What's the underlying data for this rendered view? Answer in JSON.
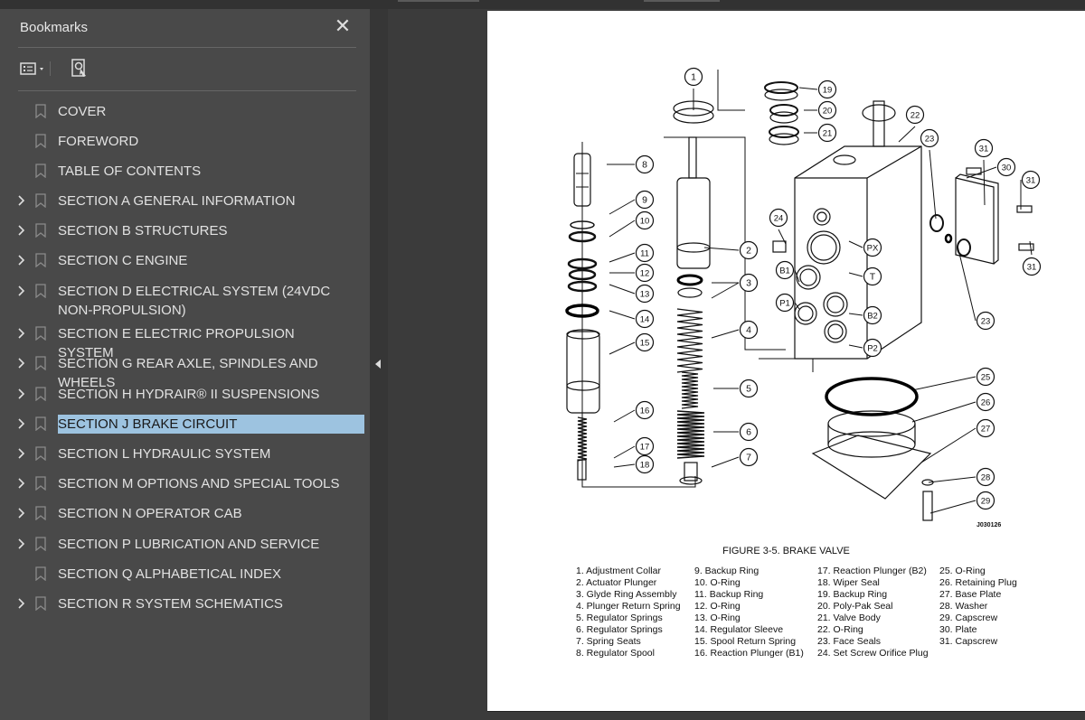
{
  "sidebar": {
    "title": "Bookmarks",
    "close_glyph": "✕",
    "items": [
      {
        "label": "COVER",
        "expandable": false
      },
      {
        "label": "FOREWORD",
        "expandable": false
      },
      {
        "label": "TABLE OF CONTENTS",
        "expandable": false
      },
      {
        "label": "SECTION A GENERAL INFORMATION",
        "expandable": true
      },
      {
        "label": "SECTION B STRUCTURES",
        "expandable": true
      },
      {
        "label": "SECTION C ENGINE",
        "expandable": true
      },
      {
        "label": "SECTION D ELECTRICAL SYSTEM (24VDC NON-PROPULSION)",
        "expandable": true
      },
      {
        "label": "SECTION E ELECTRIC PROPULSION SYSTEM",
        "expandable": true
      },
      {
        "label": "SECTION G REAR AXLE, SPINDLES AND WHEELS",
        "expandable": true
      },
      {
        "label": "SECTION H HYDRAIR® II SUSPENSIONS",
        "expandable": true
      },
      {
        "label": "SECTION J BRAKE CIRCUIT",
        "expandable": true,
        "selected": true
      },
      {
        "label": "SECTION L HYDRAULIC SYSTEM",
        "expandable": true
      },
      {
        "label": "SECTION M OPTIONS AND SPECIAL TOOLS",
        "expandable": true
      },
      {
        "label": "SECTION N OPERATOR CAB",
        "expandable": true
      },
      {
        "label": "SECTION P LUBRICATION AND SERVICE",
        "expandable": true
      },
      {
        "label": "SECTION Q ALPHABETICAL INDEX",
        "expandable": false
      },
      {
        "label": "SECTION R SYSTEM SCHEMATICS",
        "expandable": true
      }
    ]
  },
  "document": {
    "figure_title": "FIGURE 3-5. BRAKE VALVE",
    "figure_id": "J030126",
    "legend": [
      [
        "1. Adjustment Collar",
        "2. Actuator Plunger",
        "3. Glyde Ring Assembly",
        "4. Plunger Return Spring",
        "5. Regulator Springs",
        "6. Regulator Springs",
        "7. Spring Seats",
        "8. Regulator Spool"
      ],
      [
        "9. Backup Ring",
        "10. O-Ring",
        "11. Backup Ring",
        "12. O-Ring",
        "13. O-Ring",
        "14. Regulator Sleeve",
        "15. Spool Return Spring",
        "16. Reaction Plunger (B1)"
      ],
      [
        "17. Reaction Plunger (B2)",
        "18. Wiper Seal",
        "19. Backup Ring",
        "20. Poly-Pak Seal",
        "21. Valve Body",
        "22. O-Ring",
        "23. Face Seals",
        "24. Set Screw Orifice Plug"
      ],
      [
        "25. O-Ring",
        "26. Retaining Plug",
        "27. Base Plate",
        "28. Washer",
        "29. Capscrew",
        "30. Plate",
        "31. Capscrew"
      ]
    ],
    "callouts": [
      "1",
      "2",
      "3",
      "4",
      "5",
      "6",
      "7",
      "8",
      "9",
      "10",
      "11",
      "12",
      "13",
      "14",
      "15",
      "16",
      "17",
      "18",
      "19",
      "20",
      "21",
      "22",
      "23",
      "23",
      "24",
      "25",
      "26",
      "27",
      "28",
      "29",
      "30",
      "31",
      "31",
      "31",
      "PX",
      "T",
      "B1",
      "P1",
      "B2",
      "P2"
    ]
  },
  "colors": {
    "sidebar_bg": "#494949",
    "selection": "#9dc3e0",
    "page_bg": "#ffffff",
    "app_bg": "#3b3b3b"
  },
  "icons": {
    "close": "close-icon",
    "options": "list-options-icon",
    "find": "find-bookmark-icon",
    "bookmark": "bookmark-icon",
    "expand": "chevron-right-icon",
    "collapse_panel": "collapse-panel-icon"
  }
}
